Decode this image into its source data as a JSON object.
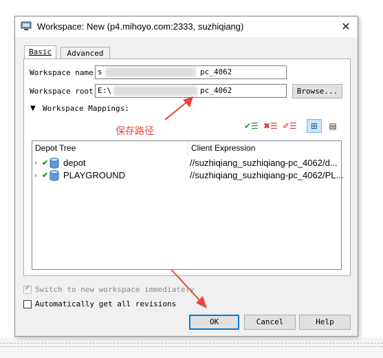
{
  "window": {
    "title": "Workspace: New (p4.mihoyo.com:2333,  suzhiqiang)",
    "close_glyph": "✕"
  },
  "tabs": [
    {
      "label": "Basic",
      "selected": true
    },
    {
      "label": "Advanced",
      "selected": false
    }
  ],
  "form": {
    "workspace_name_label": "Workspace name:",
    "workspace_name_prefix": "s",
    "workspace_name_suffix": "pc_4062",
    "workspace_root_label": "Workspace root:",
    "workspace_root_prefix": "E:\\",
    "workspace_root_suffix": "pc_4062",
    "browse_label": "Browse...",
    "mappings_label": "Workspace Mappings:"
  },
  "annotation": {
    "text": "保存路径",
    "color": "#e8453c"
  },
  "toolbar_icons": [
    "add-mapping-icon",
    "remove-mapping-icon",
    "clear-mapping-icon",
    "tree-view-icon",
    "text-view-icon"
  ],
  "tree": {
    "columns": [
      "Depot Tree",
      "Client Expression"
    ],
    "rows": [
      {
        "name": "depot",
        "expression": "//suzhiqiang_suzhiqiang-pc_4062/d..."
      },
      {
        "name": "PLAYGROUND",
        "expression": "//suzhiqiang_suzhiqiang-pc_4062/PL..."
      }
    ]
  },
  "options": {
    "switch_label": "Switch to new workspace immediately",
    "switch_checked": true,
    "switch_disabled": true,
    "auto_label": "Automatically get all revisions",
    "auto_checked": false
  },
  "buttons": {
    "ok": "OK",
    "cancel": "Cancel",
    "help": "Help"
  },
  "colors": {
    "accent": "#0078d7",
    "annotation_red": "#e8453c",
    "check_green": "#1a9a1a"
  }
}
